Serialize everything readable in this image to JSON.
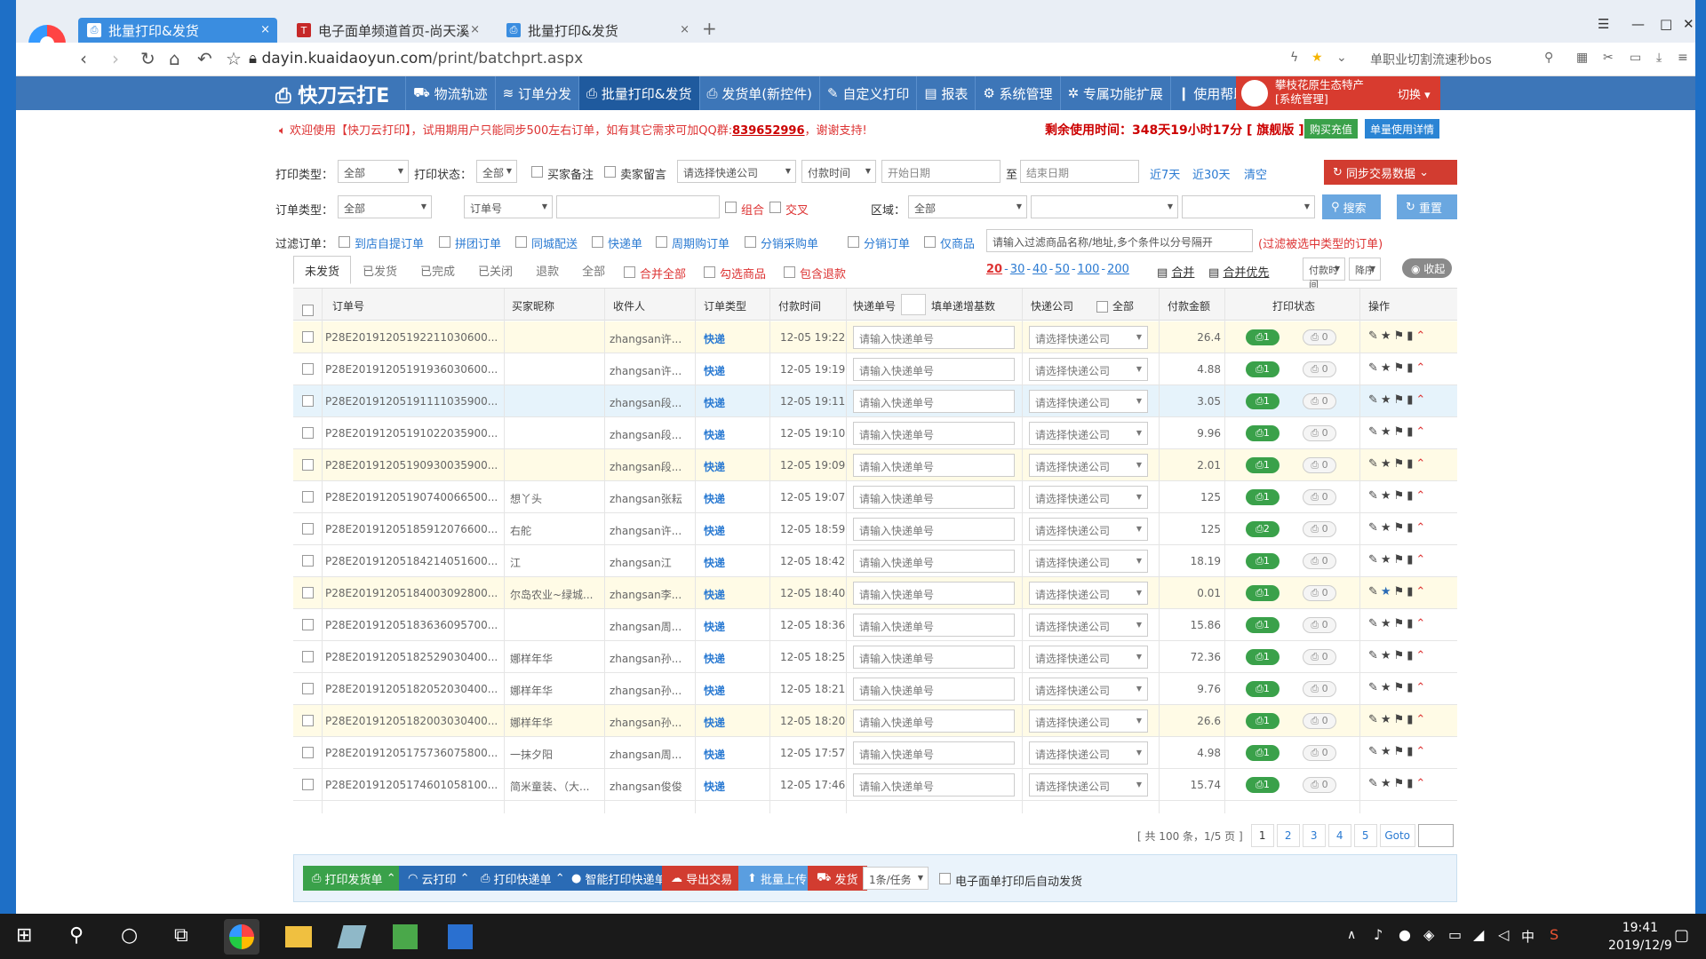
{
  "browser": {
    "tabs": [
      {
        "label": "批量打印&发货",
        "close": "×"
      },
      {
        "label": "电子面单频道首页-尚天溪",
        "close": "×"
      },
      {
        "label": "批量打印&发货",
        "close": "×"
      }
    ],
    "new_tab": "+",
    "url_host": "dayin.kuaidaoyun.com",
    "url_path": "/print/batchprt.aspx",
    "search_hint": "单职业切割流速秒bos"
  },
  "app": {
    "brand": "快刀云打E",
    "menu": [
      "物流轨迹",
      "订单分发",
      "批量打印&发货",
      "发货单(新控件)",
      "自定义打印",
      "报表",
      "系统管理",
      "专属功能扩展",
      "使用帮助"
    ],
    "user_line1": "攀枝花原生态特产",
    "user_line2": "[系统管理]",
    "switch": "切换"
  },
  "notice": {
    "text": "欢迎使用【快刀云打印】，试用期用户只能同步500左右订单，如有其它需求可加QQ群:",
    "qq": "839652996",
    "thanks": "，谢谢支持!",
    "remain": "剩余使用时间：348天19小时17分 [ 旗舰版 ]",
    "buy": "购买充值",
    "detail": "单量使用详情"
  },
  "filters": {
    "print_type_label": "打印类型：",
    "print_type": "全部",
    "print_state_label": "打印状态：",
    "print_state": "全部",
    "buyer_note": "买家备注",
    "seller_note": "卖家留言",
    "express_ph": "请选择快递公司",
    "pay_time": "付款时间",
    "start_ph": "开始日期",
    "to": "至",
    "end_ph": "结束日期",
    "d7": "近7天",
    "d30": "近30天",
    "clear": "清空",
    "sync": "同步交易数据",
    "order_type_label": "订单类型：",
    "order_type": "全部",
    "order_no": "订单号",
    "combine": "组合",
    "cross": "交叉",
    "region_label": "区域：",
    "region": "全部",
    "search": "搜索",
    "reset": "重置",
    "filter_label": "过滤订单：",
    "chips": [
      "到店自提订单",
      "拼团订单",
      "同城配送",
      "快递单",
      "周期购订单",
      "分销采购单",
      "分销订单",
      "仅商品"
    ],
    "filter_ph": "请输入过滤商品名称/地址,多个条件以分号隔开",
    "filter_hint": "(过滤被选中类型的订单)"
  },
  "subtabs": [
    "未发货",
    "已发货",
    "已完成",
    "已关闭",
    "退款",
    "全部"
  ],
  "tab_opts": [
    "合并全部",
    "勾选商品",
    "包含退款"
  ],
  "page_sizes": [
    "20",
    "30",
    "40",
    "50",
    "100",
    "200"
  ],
  "merge": "合并",
  "merge_first": "合并优先",
  "sort": "付款时间",
  "order": "降序",
  "collapse": "收起",
  "table": {
    "headers": [
      "订单号",
      "买家昵称",
      "收件人",
      "订单类型",
      "付款时间",
      "快递单号",
      "填单递增基数",
      "快递公司",
      "全部",
      "付款金额",
      "打印状态",
      "操作"
    ],
    "tracking_ph": "请输入快递单号",
    "company_ph": "请选择快递公司",
    "rows": [
      {
        "id": "P28E20191205192211030600...",
        "buyer": "",
        "recv": "zhangsan许...",
        "type": "快递",
        "time": "12-05 19:22",
        "amount": "26.4",
        "p": "1",
        "q": "0"
      },
      {
        "id": "P28E20191205191936030600...",
        "buyer": "",
        "recv": "zhangsan许...",
        "type": "快递",
        "time": "12-05 19:19",
        "amount": "4.88",
        "p": "1",
        "q": "0"
      },
      {
        "id": "P28E20191205191111035900...",
        "buyer": "",
        "recv": "zhangsan段...",
        "type": "快递",
        "time": "12-05 19:11",
        "amount": "3.05",
        "p": "1",
        "q": "0"
      },
      {
        "id": "P28E20191205191022035900...",
        "buyer": "",
        "recv": "zhangsan段...",
        "type": "快递",
        "time": "12-05 19:10",
        "amount": "9.96",
        "p": "1",
        "q": "0"
      },
      {
        "id": "P28E20191205190930035900...",
        "buyer": "",
        "recv": "zhangsan段...",
        "type": "快递",
        "time": "12-05 19:09",
        "amount": "2.01",
        "p": "1",
        "q": "0"
      },
      {
        "id": "P28E20191205190740066500...",
        "buyer": "想丫头",
        "recv": "zhangsan张耘",
        "type": "快递",
        "time": "12-05 19:07",
        "amount": "125",
        "p": "1",
        "q": "0"
      },
      {
        "id": "P28E20191205185912076600...",
        "buyer": "右舵",
        "recv": "zhangsan许...",
        "type": "快递",
        "time": "12-05 18:59",
        "amount": "125",
        "p": "2",
        "q": "0"
      },
      {
        "id": "P28E20191205184214051600...",
        "buyer": "江",
        "recv": "zhangsan江",
        "type": "快递",
        "time": "12-05 18:42",
        "amount": "18.19",
        "p": "1",
        "q": "0"
      },
      {
        "id": "P28E20191205184003092800...",
        "buyer": "尔岛农业~绿城...",
        "recv": "zhangsan李...",
        "type": "快递",
        "time": "12-05 18:40",
        "amount": "0.01",
        "p": "1",
        "q": "0"
      },
      {
        "id": "P28E20191205183636095700...",
        "buyer": "",
        "recv": "zhangsan周...",
        "type": "快递",
        "time": "12-05 18:36",
        "amount": "15.86",
        "p": "1",
        "q": "0"
      },
      {
        "id": "P28E20191205182529030400...",
        "buyer": "娜样年华",
        "recv": "zhangsan孙...",
        "type": "快递",
        "time": "12-05 18:25",
        "amount": "72.36",
        "p": "1",
        "q": "0"
      },
      {
        "id": "P28E20191205182052030400...",
        "buyer": "娜样年华",
        "recv": "zhangsan孙...",
        "type": "快递",
        "time": "12-05 18:21",
        "amount": "9.76",
        "p": "1",
        "q": "0"
      },
      {
        "id": "P28E20191205182003030400...",
        "buyer": "娜样年华",
        "recv": "zhangsan孙...",
        "type": "快递",
        "time": "12-05 18:20",
        "amount": "26.6",
        "p": "1",
        "q": "0"
      },
      {
        "id": "P28E20191205175736075800...",
        "buyer": "一抹夕阳",
        "recv": "zhangsan周...",
        "type": "快递",
        "time": "12-05 17:57",
        "amount": "4.98",
        "p": "1",
        "q": "0"
      },
      {
        "id": "P28E20191205174601058100...",
        "buyer": "简米童装、（大...",
        "recv": "zhangsan俊俊",
        "type": "快递",
        "time": "12-05 17:46",
        "amount": "15.74",
        "p": "1",
        "q": "0"
      }
    ]
  },
  "pager": {
    "summary": "[ 共 100 条，1/5 页 ]",
    "pages": [
      "1",
      "2",
      "3",
      "4",
      "5"
    ],
    "goto": "Goto"
  },
  "toolbar": {
    "print_invoice": "打印发货单",
    "cloud_print": "云打印",
    "print_express": "打印快递单",
    "smart_print": "智能打印快递单",
    "export": "导出交易",
    "upload": "批量上传",
    "ship": "发货",
    "per_task": "1条/任务",
    "auto_ship": "电子面单打印后自动发货"
  },
  "taskbar": {
    "time": "19:41",
    "date": "2019/12/9",
    "ime": "中"
  }
}
